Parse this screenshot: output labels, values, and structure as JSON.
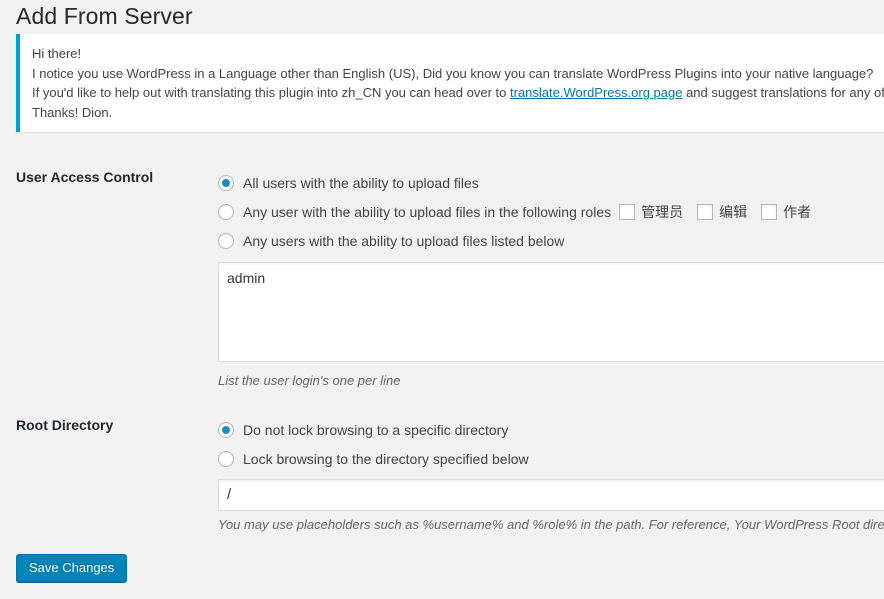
{
  "page": {
    "title": "Add From Server"
  },
  "notice": {
    "accent_color": "#00a0d2",
    "link_color": "#0073aa",
    "line1": "Hi there!",
    "line2": "I notice you use WordPress in a Language other than English (US), Did you know you can translate WordPress Plugins into your native language?",
    "line3_before": "If you'd like to help out with translating this plugin into zh_CN you can head over to ",
    "line3_link": "translate.WordPress.org page",
    "line3_after": " and suggest translations for any of the strings.",
    "line4": "Thanks! Dion."
  },
  "user_access_control": {
    "label": "User Access Control",
    "options": [
      {
        "label": "All users with the ability to upload files",
        "selected": true
      },
      {
        "label": "Any user with the ability to upload files in the following roles",
        "selected": false
      },
      {
        "label": "Any users with the ability to upload files listed below",
        "selected": false
      }
    ],
    "roles": [
      {
        "label": "管理员",
        "checked": false
      },
      {
        "label": "编辑",
        "checked": false
      },
      {
        "label": "作者",
        "checked": false
      }
    ],
    "users_textarea_value": "admin",
    "users_help": "List the user login's one per line"
  },
  "root_directory": {
    "label": "Root Directory",
    "options": [
      {
        "label": "Do not lock browsing to a specific directory",
        "selected": true
      },
      {
        "label": "Lock browsing to the directory specified below",
        "selected": false
      }
    ],
    "path_value": "/",
    "path_help": "You may use placeholders such as %username% and %role% in the path.  For reference, Your WordPress Root directory is:"
  },
  "submit": {
    "save_label": "Save Changes",
    "color": "#0085ba"
  }
}
